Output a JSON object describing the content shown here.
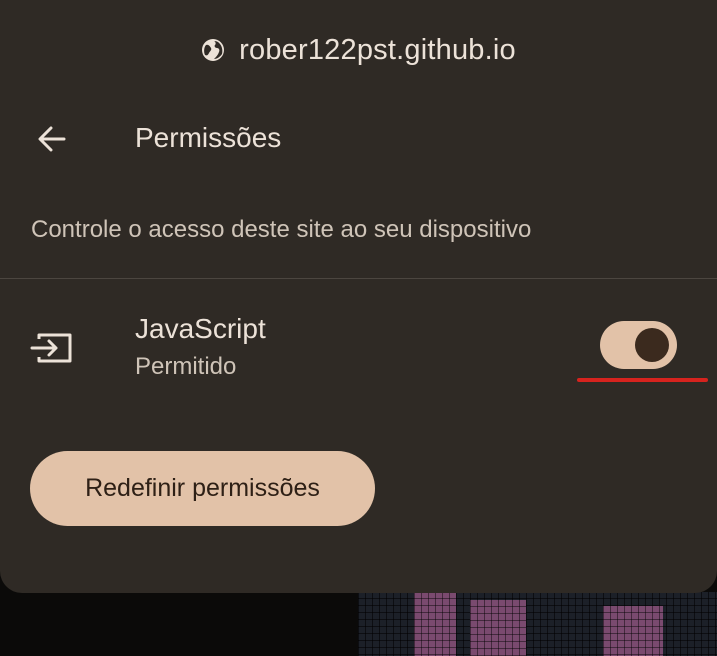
{
  "site": {
    "host": "rober122pst.github.io",
    "icon": "globe-icon"
  },
  "header": {
    "back_icon": "back-arrow-icon",
    "title": "Permissões"
  },
  "description": "Controle o acesso deste site ao seu dispositivo",
  "permissions": [
    {
      "name": "JavaScript",
      "status": "Permitido",
      "icon": "input-arrow-icon",
      "enabled": true
    }
  ],
  "actions": {
    "reset_label": "Redefinir permissões"
  },
  "colors": {
    "sheet_background": "#2f2a25",
    "accent": "#e2c2a8",
    "knob": "#3b2a1e",
    "annotation": "#d6231e",
    "text_primary": "#ece2d8",
    "text_secondary": "#cfc4b8"
  }
}
